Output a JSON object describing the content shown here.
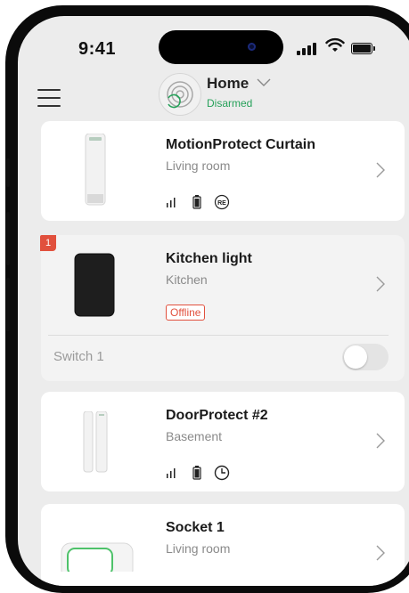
{
  "status_bar": {
    "time": "9:41"
  },
  "header": {
    "title": "Home",
    "status": "Disarmed",
    "status_color": "#27a15a"
  },
  "devices": [
    {
      "name": "MotionProtect Curtain",
      "room": "Living room",
      "icons": [
        "signal-icon",
        "battery-icon",
        "range-extender-icon"
      ],
      "re_label": "RE"
    },
    {
      "name": "Kitchen light",
      "room": "Kitchen",
      "badge": "1",
      "status": "Offline",
      "switch_label": "Switch 1",
      "switch_on": false
    },
    {
      "name": "DoorProtect #2",
      "room": "Basement",
      "icons": [
        "signal-icon",
        "battery-icon",
        "delay-clock-icon"
      ]
    },
    {
      "name": "Socket 1",
      "room": "Living room"
    }
  ],
  "colors": {
    "accent_green": "#27a15a",
    "alert_red": "#e1503d",
    "background": "#ececec"
  }
}
